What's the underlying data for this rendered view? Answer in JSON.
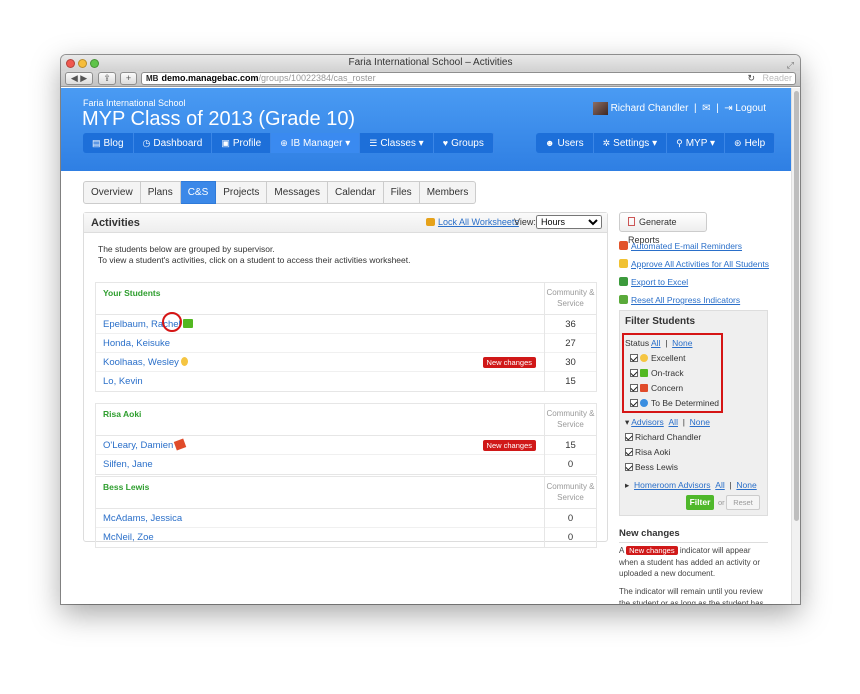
{
  "window": {
    "title": "Faria International School – Activities"
  },
  "browser": {
    "url_host": "demo.managebac.com",
    "url_path": "/groups/10022384/cas_roster",
    "reader_label": "Reader",
    "mb_label": "MB"
  },
  "header": {
    "school": "Faria International School",
    "page_title": "MYP Class of 2013 (Grade 10)",
    "user_name": "Richard Chandler",
    "logout": "Logout"
  },
  "nav": {
    "left": [
      "Blog",
      "Dashboard",
      "Profile",
      "IB Manager",
      "Classes",
      "Groups"
    ],
    "right": [
      "Users",
      "Settings",
      "MYP",
      "Help"
    ]
  },
  "tabs": [
    "Overview",
    "Plans",
    "C&S",
    "Projects",
    "Messages",
    "Calendar",
    "Files",
    "Members"
  ],
  "panel": {
    "title": "Activities",
    "lock_link": "Lock All Worksheets",
    "view_label": "View:",
    "view_value": "Hours",
    "intro_line1": "The students below are grouped by supervisor.",
    "intro_line2": "To view a student's activities, click on a student to access their activities worksheet.",
    "col_header_1": "Community &",
    "col_header_2": "Service",
    "groups": [
      {
        "name": "Your Students",
        "students": [
          {
            "name": "Epelbaum, Rachel",
            "value": "36",
            "badge": "",
            "icon": "green-flag-icon"
          },
          {
            "name": "Honda, Keisuke",
            "value": "27",
            "badge": "",
            "icon": ""
          },
          {
            "name": "Koolhaas, Wesley",
            "value": "30",
            "badge": "New changes",
            "icon": "medal-icon"
          },
          {
            "name": "Lo, Kevin",
            "value": "15",
            "badge": "",
            "icon": ""
          }
        ]
      },
      {
        "name": "Risa Aoki",
        "students": [
          {
            "name": "O'Leary, Damien",
            "value": "15",
            "badge": "New changes",
            "icon": "thumbs-down-icon"
          },
          {
            "name": "Silfen, Jane",
            "value": "0",
            "badge": "",
            "icon": ""
          }
        ]
      },
      {
        "name": "Bess Lewis",
        "students": [
          {
            "name": "McAdams, Jessica",
            "value": "0",
            "badge": "",
            "icon": ""
          },
          {
            "name": "McNeil, Zoe",
            "value": "0",
            "badge": "",
            "icon": ""
          }
        ]
      }
    ]
  },
  "sidebar": {
    "generate_reports": "Generate Reports",
    "links": [
      "Automated E-mail Reminders",
      "Approve All Activities for All Students",
      "Export to Excel",
      "Reset All Progress Indicators"
    ],
    "filter": {
      "title": "Filter Students",
      "status_label": "Status",
      "all": "All",
      "none": "None",
      "statuses": [
        "Excellent",
        "On-track",
        "Concern",
        "To Be Determined"
      ],
      "advisors_label": "Advisors",
      "advisors": [
        "Richard Chandler",
        "Risa Aoki",
        "Bess Lewis"
      ],
      "homeroom_label": "Homeroom Advisors",
      "filter_btn": "Filter",
      "or": "or",
      "reset_btn": "Reset"
    },
    "new_changes": {
      "title": "New changes",
      "text_a": "A",
      "badge": "New changes",
      "text_b": "indicator will appear when a student has added an activity or uploaded a new document.",
      "text_c": "The indicator will remain until you review the student or as long as the student has activities requiring approval."
    }
  },
  "colors": {
    "header_blue": "#3a8af0",
    "nav_blue": "#1d6fd9",
    "badge_red": "#d01818",
    "green": "#2e9e2e"
  }
}
